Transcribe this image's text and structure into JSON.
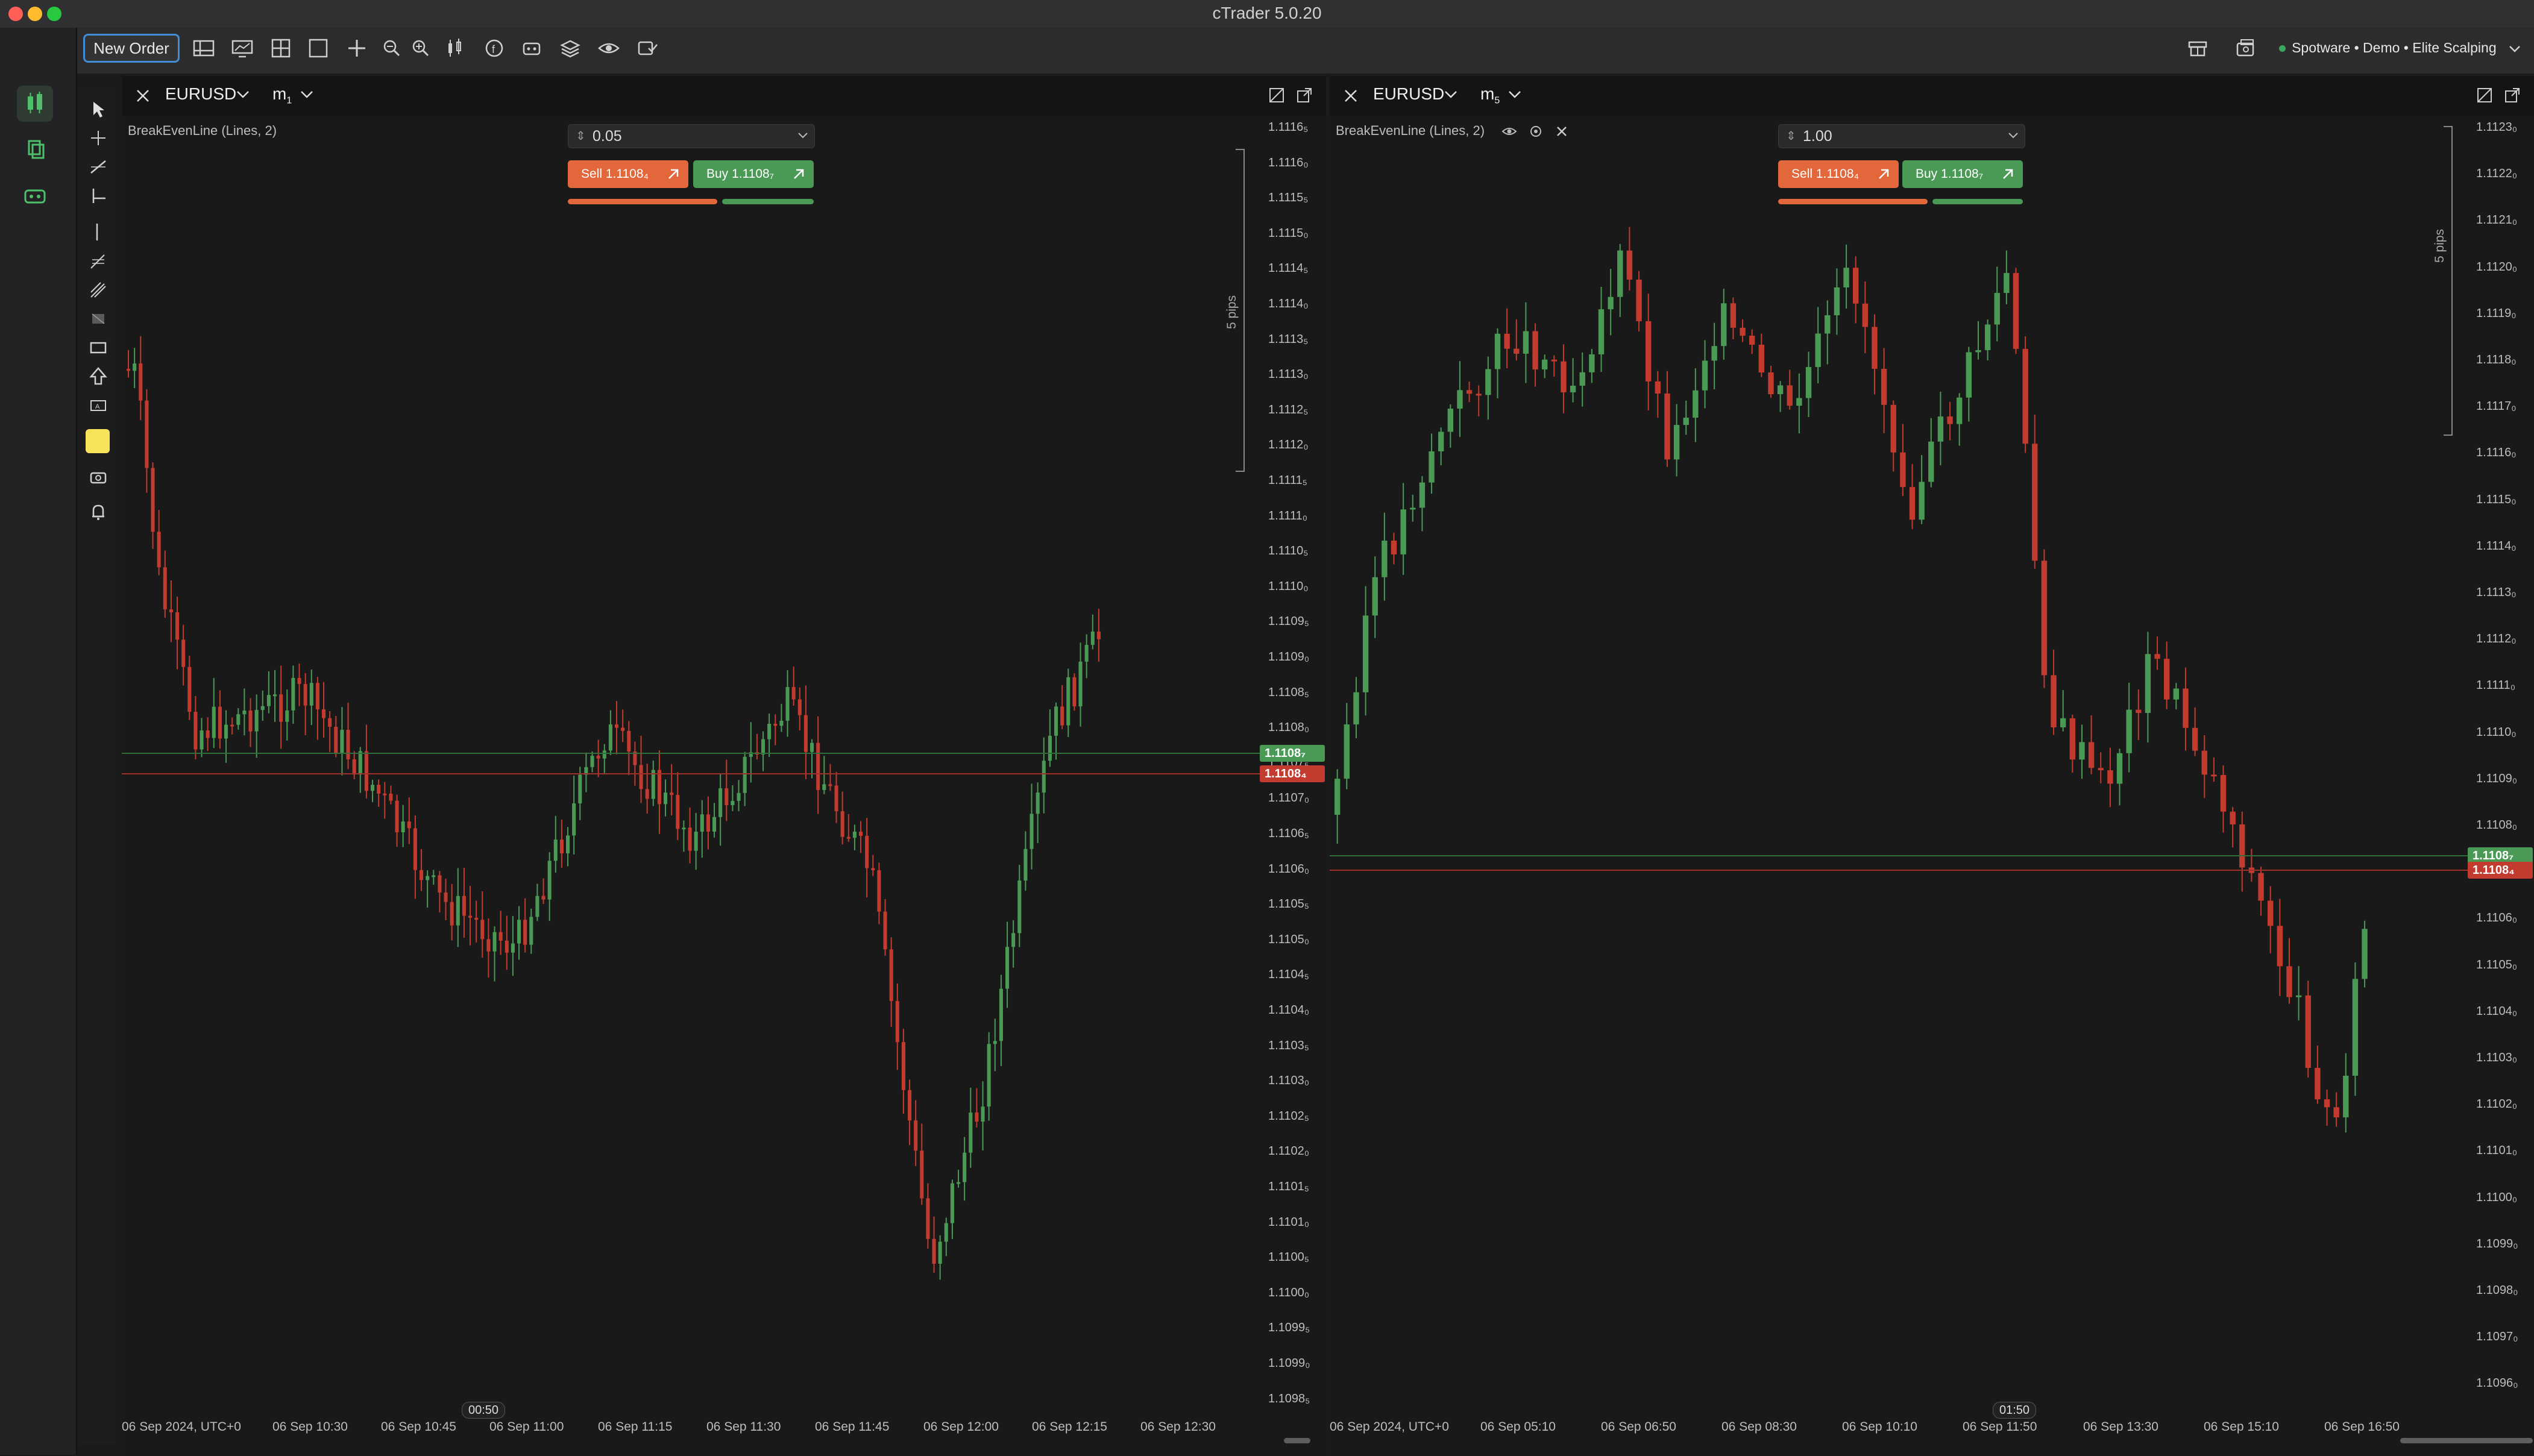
{
  "app": {
    "title": "cTrader 5.0.20",
    "account": "Spotware • Demo • Elite Scalping"
  },
  "toolbar": {
    "new_order_label": "New Order",
    "icons": [
      "layout-icon",
      "monitor-icon",
      "grid-icon",
      "square-icon",
      "crosshair-plus-icon",
      "zoom-out-icon",
      "zoom-in-icon",
      "candles-icon",
      "facebook-icon",
      "bot-icon",
      "layers-icon",
      "eye-icon",
      "trade-toggle-icon"
    ],
    "right_icons": [
      "store-icon",
      "cashier-icon"
    ]
  },
  "sidebar": {
    "items": [
      "trade-app-icon",
      "copy-app-icon",
      "algo-app-icon"
    ]
  },
  "drawing_tools": [
    "cursor-icon",
    "crosshair-icon",
    "trendline-icon",
    "measure-icon",
    "vertical-line-icon",
    "fibonacci-icon",
    "pitchfork-icon",
    "pattern-icon",
    "rectangle-icon",
    "arrow-up-icon",
    "text-box-icon",
    "color-swatch",
    "camera-icon",
    "bell-icon"
  ],
  "colors": {
    "bull": "#4a9a56",
    "bear": "#c23b2e",
    "sell_button": "#e2673a",
    "buy_button": "#4a9a56",
    "accent": "#3f8ed6"
  },
  "charts": [
    {
      "symbol": "EURUSD",
      "timeframe_main": "m",
      "timeframe_sub": "1",
      "indicator": "BreakEvenLine (Lines, 2)",
      "quantity": "0.05",
      "sell_label": "Sell 1.1108₄",
      "buy_label": "Buy 1.1108₇",
      "pips_label": "5 pips",
      "countdown": "00:50",
      "ask_badge": "1.1108₇",
      "bid_badge": "1.1108₄",
      "price_ticks": [
        "1.1116₅",
        "1.1116₀",
        "1.1115₅",
        "1.1115₀",
        "1.1114₅",
        "1.1114₀",
        "1.1113₅",
        "1.1113₀",
        "1.1112₅",
        "1.1112₀",
        "1.1111₅",
        "1.1111₀",
        "1.1110₅",
        "1.1110₀",
        "1.1109₅",
        "1.1109₀",
        "1.1108₅",
        "1.1108₀",
        "1.1107₅",
        "1.1107₀",
        "1.1106₅",
        "1.1106₀",
        "1.1105₅",
        "1.1105₀",
        "1.1104₅",
        "1.1104₀",
        "1.1103₅",
        "1.1103₀",
        "1.1102₅",
        "1.1102₀",
        "1.1101₅",
        "1.1101₀",
        "1.1100₅",
        "1.1100₀",
        "1.1099₅",
        "1.1099₀",
        "1.1098₅"
      ],
      "time_ticks": [
        "06 Sep 2024, UTC+0",
        "06 Sep 10:30",
        "06 Sep 10:45",
        "06 Sep 11:00",
        "06 Sep 11:15",
        "06 Sep 11:30",
        "06 Sep 11:45",
        "06 Sep 12:00",
        "06 Sep 12:15",
        "06 Sep 12:30"
      ]
    },
    {
      "symbol": "EURUSD",
      "timeframe_main": "m",
      "timeframe_sub": "5",
      "indicator": "BreakEvenLine (Lines, 2)",
      "quantity": "1.00",
      "sell_label": "Sell 1.1108₄",
      "buy_label": "Buy 1.1108₇",
      "pips_label": "5 pips",
      "countdown": "01:50",
      "ask_badge": "1.1108₇",
      "bid_badge": "1.1108₄",
      "price_ticks": [
        "1.1123₀",
        "1.1122₀",
        "1.1121₀",
        "1.1120₀",
        "1.1119₀",
        "1.1118₀",
        "1.1117₀",
        "1.1116₀",
        "1.1115₀",
        "1.1114₀",
        "1.1113₀",
        "1.1112₀",
        "1.1111₀",
        "1.1110₀",
        "1.1109₀",
        "1.1108₀",
        "1.1107₀",
        "1.1106₀",
        "1.1105₀",
        "1.1104₀",
        "1.1103₀",
        "1.1102₀",
        "1.1101₀",
        "1.1100₀",
        "1.1099₀",
        "1.1098₀",
        "1.1097₀",
        "1.1096₀"
      ],
      "time_ticks": [
        "06 Sep 2024, UTC+0",
        "06 Sep 05:10",
        "06 Sep 06:50",
        "06 Sep 08:30",
        "06 Sep 10:10",
        "06 Sep 11:50",
        "06 Sep 13:30",
        "06 Sep 15:10",
        "06 Sep 16:50"
      ]
    }
  ]
}
